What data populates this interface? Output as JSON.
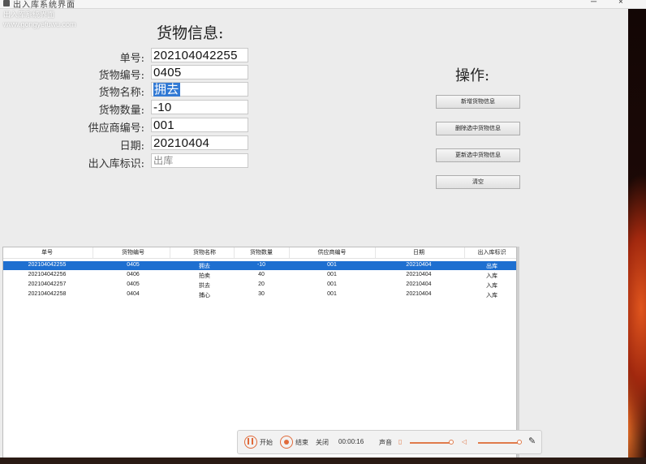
{
  "window": {
    "title": "出入库系统界面",
    "watermark_line1": "出入库系统界面",
    "watermark_line2": "www.gongyefuwu.com",
    "minimize": "─",
    "close": "×"
  },
  "form": {
    "title": "货物信息:",
    "fields": [
      {
        "label": "单号:",
        "value": "202104042255"
      },
      {
        "label": "货物编号:",
        "value": "0405"
      },
      {
        "label": "货物名称:",
        "value": "拥去"
      },
      {
        "label": "货物数量:",
        "value": "-10"
      },
      {
        "label": "供应商编号:",
        "value": "001"
      },
      {
        "label": "日期:",
        "value": "20210404"
      },
      {
        "label": "出入库标识:",
        "value": "出库"
      }
    ]
  },
  "operations": {
    "title": "操作:",
    "buttons": [
      "新增货物信息",
      "删除选中货物信息",
      "更新选中货物信息",
      "清空"
    ]
  },
  "table": {
    "columns": [
      "单号",
      "货物编号",
      "货物名称",
      "货物数量",
      "供应商编号",
      "日期",
      "出入库标识"
    ],
    "rows": [
      [
        "202104042255",
        "0405",
        "拥去",
        "-10",
        "001",
        "20210404",
        "出库"
      ],
      [
        "202104042256",
        "0406",
        "拍卖",
        "40",
        "001",
        "20210404",
        "入库"
      ],
      [
        "202104042257",
        "0405",
        "拱去",
        "20",
        "001",
        "20210404",
        "入库"
      ],
      [
        "202104042258",
        "0404",
        "捕心",
        "30",
        "001",
        "20210404",
        "入库"
      ]
    ],
    "selected_row": 0
  },
  "recorder": {
    "pause_label": "开始",
    "stop_label": "结束",
    "mode_label": "关闭",
    "timer": "00:00:16",
    "speed_label": "声音"
  },
  "colors": {
    "selection": "#1e6fd0",
    "accent": "#e06a3a"
  }
}
